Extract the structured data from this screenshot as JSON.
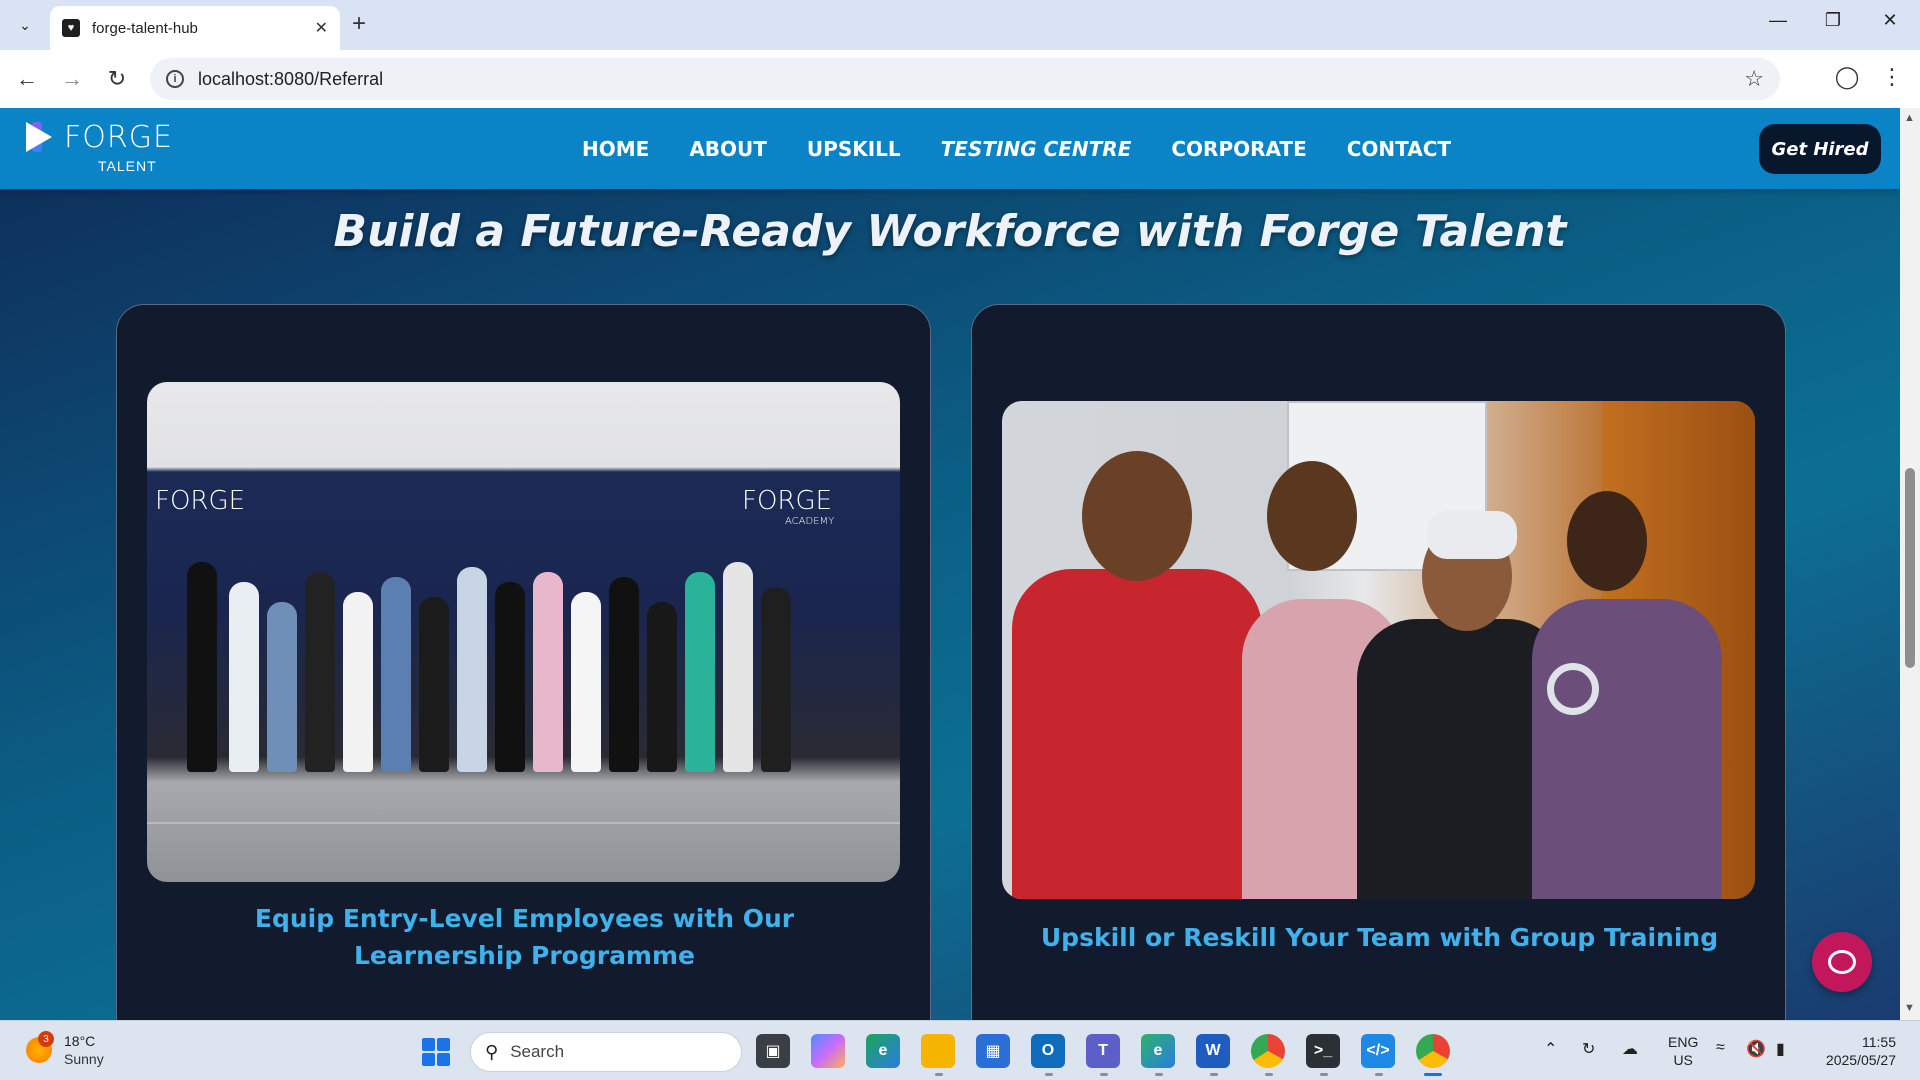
{
  "browser": {
    "tab_title": "forge-talent-hub",
    "url": "localhost:8080/Referral"
  },
  "site": {
    "logo_text": "FORGE",
    "logo_sub": "TALENT",
    "nav": [
      {
        "label": "HOME"
      },
      {
        "label": "ABOUT"
      },
      {
        "label": "UPSKILL"
      },
      {
        "label": "TESTING CENTRE"
      },
      {
        "label": "CORPORATE"
      },
      {
        "label": "CONTACT"
      }
    ],
    "cta_label": "Get Hired",
    "heading": "Build a Future-Ready Workforce with Forge Talent",
    "cards": [
      {
        "caption": "Equip Entry-Level Employees with Our Learnership Programme",
        "banner_text": "FORGE",
        "banner_sub": "ACADEMY"
      },
      {
        "caption": "Upskill or Reskill Your Team with Group Training"
      }
    ]
  },
  "taskbar": {
    "weather_temp": "18°C",
    "weather_cond": "Sunny",
    "weather_badge": "3",
    "search_placeholder": "Search",
    "lang_line1": "ENG",
    "lang_line2": "US",
    "time": "11:55",
    "date": "2025/05/27"
  },
  "colors": {
    "header_bg": "#0a84c6",
    "cta_bg": "#07182d",
    "caption": "#3fb2ec",
    "chat_fab": "#c2185b"
  }
}
